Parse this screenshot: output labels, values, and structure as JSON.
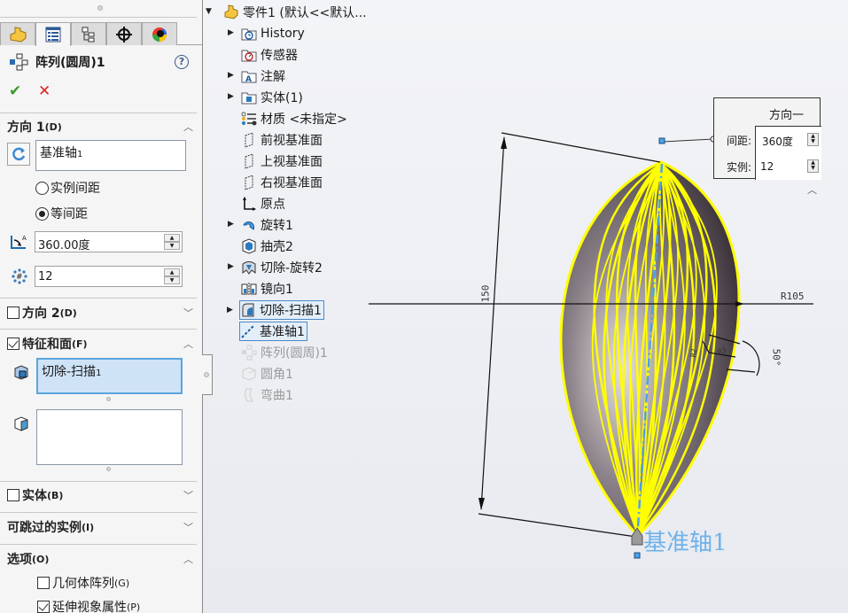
{
  "property_manager": {
    "tabs": [
      {
        "name": "featuremanager",
        "icon": "part-icon"
      },
      {
        "name": "propertymanager",
        "icon": "property-list-icon",
        "active": true
      },
      {
        "name": "configurationmanager",
        "icon": "config-tree-icon"
      },
      {
        "name": "dimxpert",
        "icon": "crosshair-icon"
      },
      {
        "name": "display",
        "icon": "appearance-ball-icon"
      }
    ],
    "title": "阵列(圆周)1",
    "help": "?",
    "ok": "✔",
    "cancel": "✕",
    "direction1": {
      "heading": "方向 1",
      "shortcut": "(D)",
      "axis_value": "基准轴",
      "axis_suffix": "1",
      "radio_instance_spacing": "实例间距",
      "radio_equal_spacing": "等间距",
      "selected_radio": "等间距",
      "angle_value": "360.00度",
      "count_value": "12"
    },
    "direction2": {
      "heading": "方向 2",
      "shortcut": "(D)",
      "checked": false
    },
    "features_faces": {
      "heading": "特征和面",
      "shortcut": "(F)",
      "checked": true,
      "feature_value": "切除-扫描",
      "feature_suffix": "1",
      "faces_value": ""
    },
    "bodies": {
      "heading": "实体",
      "shortcut": "(B)",
      "checked": false
    },
    "skip_instances": {
      "heading": "可跳过的实例",
      "shortcut": "(I)"
    },
    "options": {
      "heading": "选项",
      "shortcut": "(O)",
      "geometry_pattern": {
        "label": "几何体阵列",
        "shortcut": "(G)",
        "checked": false
      },
      "propagate_visual": {
        "label": "延伸视象属性",
        "shortcut": "(P)",
        "checked": true
      }
    }
  },
  "feature_tree": {
    "root": "零件1  (默认<<默认...",
    "items": [
      {
        "label": "History",
        "expandable": true,
        "icon": "history-folder-icon"
      },
      {
        "label": "传感器",
        "expandable": false,
        "icon": "sensor-folder-icon"
      },
      {
        "label": "注解",
        "expandable": true,
        "icon": "annotation-folder-icon"
      },
      {
        "label": "实体(1)",
        "expandable": true,
        "icon": "solid-bodies-folder-icon"
      },
      {
        "label": "材质 <未指定>",
        "expandable": false,
        "icon": "material-icon"
      },
      {
        "label": "前视基准面",
        "expandable": false,
        "icon": "plane-icon"
      },
      {
        "label": "上视基准面",
        "expandable": false,
        "icon": "plane-icon"
      },
      {
        "label": "右视基准面",
        "expandable": false,
        "icon": "plane-icon"
      },
      {
        "label": "原点",
        "expandable": false,
        "icon": "origin-icon"
      },
      {
        "label": "旋转1",
        "expandable": true,
        "icon": "revolve-icon"
      },
      {
        "label": "抽壳2",
        "expandable": false,
        "icon": "shell-icon"
      },
      {
        "label": "切除-旋转2",
        "expandable": true,
        "icon": "cut-revolve-icon"
      },
      {
        "label": "镜向1",
        "expandable": false,
        "icon": "mirror-icon"
      },
      {
        "label": "切除-扫描1",
        "expandable": true,
        "icon": "cut-sweep-icon",
        "selected": true
      },
      {
        "label": "基准轴1",
        "expandable": false,
        "icon": "axis-icon",
        "selected": true
      },
      {
        "label": "阵列(圆周)1",
        "expandable": false,
        "icon": "circular-pattern-icon",
        "muted": true
      },
      {
        "label": "圆角1",
        "expandable": false,
        "icon": "fillet-icon",
        "muted": true
      },
      {
        "label": "弯曲1",
        "expandable": false,
        "icon": "flex-icon",
        "muted": true
      }
    ]
  },
  "graphics": {
    "callout": {
      "heading": "方向一",
      "spacing_label": "间距:",
      "spacing_value": "360度",
      "instances_label": "实例:",
      "instances_value": "12"
    },
    "dimensions": {
      "height": "150",
      "radius": "R105",
      "angle": "50°",
      "small_dim_a": "R2",
      "small_dim_b": "R3"
    },
    "axis_label": "基准轴1",
    "colors": {
      "highlight": "#ffff00",
      "axis": "#4aa3e8",
      "body_dark": "#4a4048",
      "body_light": "#d8d0cc"
    }
  }
}
